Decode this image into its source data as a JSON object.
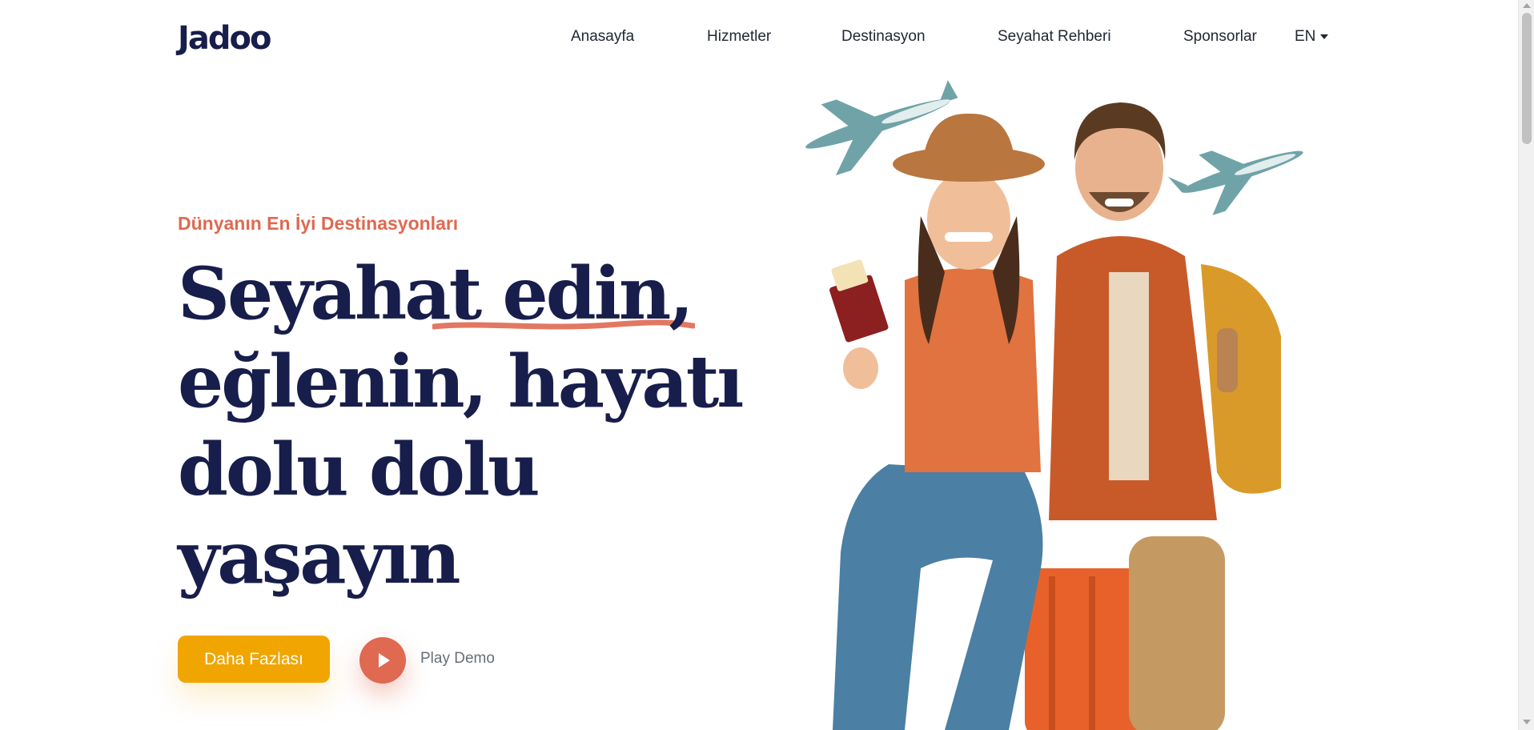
{
  "header": {
    "logo_text": "Jadoo",
    "nav": [
      {
        "label": "Anasayfa"
      },
      {
        "label": "Hizmetler"
      },
      {
        "label": "Destinasyon"
      },
      {
        "label": "Seyahat Rehberi"
      },
      {
        "label": "Sponsorlar"
      }
    ],
    "language": "EN"
  },
  "hero": {
    "tagline": "Dünyanın En İyi Destinasyonları",
    "title_lines": [
      "Seyahat edin,",
      "eğlenin, hayatı",
      "dolu dolu",
      "yaşayın"
    ],
    "primary_button": "Daha Fazlası",
    "play_label": "Play Demo"
  },
  "colors": {
    "accent_yellow": "#f1a501",
    "accent_coral": "#df6951",
    "heading_navy": "#181e4b",
    "plane_teal": "#6fa3a8"
  },
  "icons": {
    "play": "play-icon",
    "dropdown": "caret-down-icon",
    "plane": "airplane-icon"
  }
}
